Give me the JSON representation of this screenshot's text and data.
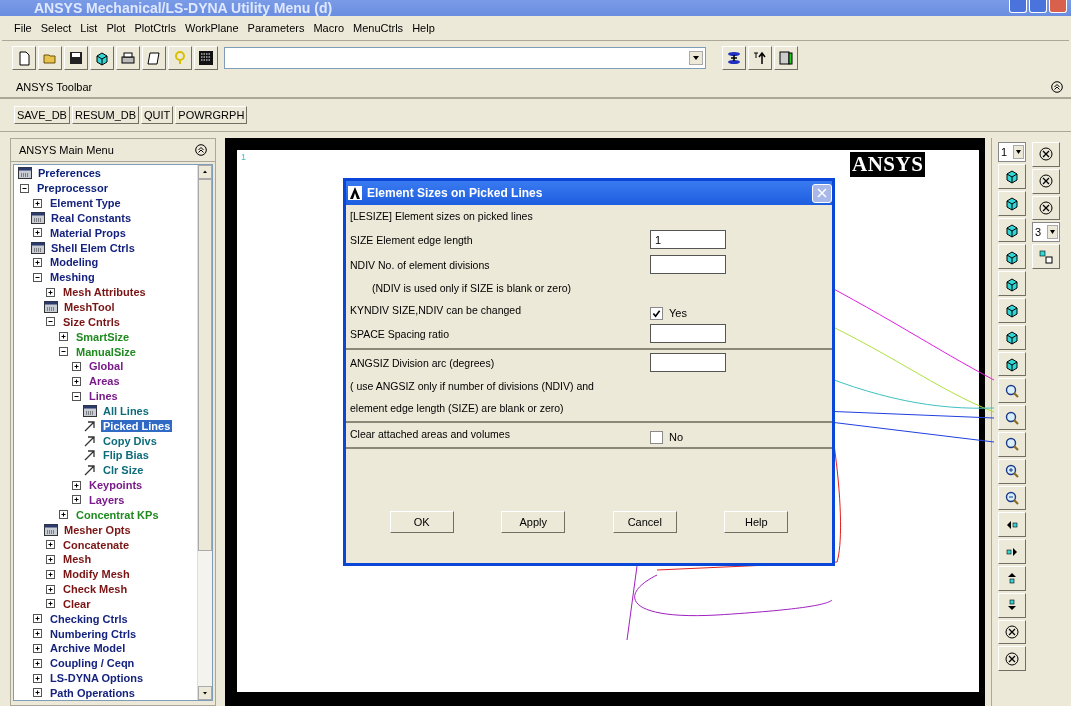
{
  "window": {
    "title": "ANSYS Mechanical/LS-DYNA Utility Menu (d)"
  },
  "menu": [
    "File",
    "Select",
    "List",
    "Plot",
    "PlotCtrls",
    "WorkPlane",
    "Parameters",
    "Macro",
    "MenuCtrls",
    "Help"
  ],
  "toolbar": {
    "title": "ANSYS Toolbar",
    "buttons": [
      "SAVE_DB",
      "RESUM_DB",
      "QUIT",
      "POWRGRPH"
    ]
  },
  "main_menu": {
    "title": "ANSYS Main Menu",
    "items": [
      {
        "label": "Preferences",
        "kind": "dialog",
        "selected": false
      },
      {
        "label": "Preprocessor",
        "kind": "folder",
        "expanded": true,
        "selected": false,
        "children": [
          {
            "label": "Element Type",
            "kind": "folder",
            "expanded": false,
            "selected": false
          },
          {
            "label": "Real Constants",
            "kind": "dialog",
            "selected": false
          },
          {
            "label": "Material Props",
            "kind": "folder",
            "expanded": false,
            "selected": false
          },
          {
            "label": "Shell Elem Ctrls",
            "kind": "dialog",
            "selected": false
          },
          {
            "label": "Modeling",
            "kind": "folder",
            "expanded": false,
            "selected": false
          },
          {
            "label": "Meshing",
            "kind": "folder",
            "expanded": true,
            "selected": false,
            "children": [
              {
                "label": "Mesh Attributes",
                "kind": "folder",
                "expanded": false,
                "selected": false
              },
              {
                "label": "MeshTool",
                "kind": "dialog",
                "selected": false
              },
              {
                "label": "Size Cntrls",
                "kind": "folder",
                "expanded": true,
                "selected": false,
                "children": [
                  {
                    "label": "SmartSize",
                    "kind": "folder",
                    "expanded": false,
                    "selected": false
                  },
                  {
                    "label": "ManualSize",
                    "kind": "folder",
                    "expanded": true,
                    "selected": false,
                    "children": [
                      {
                        "label": "Global",
                        "kind": "folder",
                        "expanded": false,
                        "selected": false
                      },
                      {
                        "label": "Areas",
                        "kind": "folder",
                        "expanded": false,
                        "selected": false
                      },
                      {
                        "label": "Lines",
                        "kind": "folder",
                        "expanded": true,
                        "selected": false,
                        "children": [
                          {
                            "label": "All Lines",
                            "kind": "dialog",
                            "selected": false
                          },
                          {
                            "label": "Picked Lines",
                            "kind": "picker",
                            "selected": true
                          },
                          {
                            "label": "Copy Divs",
                            "kind": "picker",
                            "selected": false
                          },
                          {
                            "label": "Flip Bias",
                            "kind": "picker",
                            "selected": false
                          },
                          {
                            "label": "Clr Size",
                            "kind": "picker",
                            "selected": false
                          }
                        ]
                      },
                      {
                        "label": "Keypoints",
                        "kind": "folder",
                        "expanded": false,
                        "selected": false
                      },
                      {
                        "label": "Layers",
                        "kind": "folder",
                        "expanded": false,
                        "selected": false
                      }
                    ]
                  },
                  {
                    "label": "Concentrat KPs",
                    "kind": "folder",
                    "expanded": false,
                    "selected": false
                  }
                ]
              },
              {
                "label": "Mesher Opts",
                "kind": "dialog",
                "selected": false
              },
              {
                "label": "Concatenate",
                "kind": "folder",
                "expanded": false,
                "selected": false
              },
              {
                "label": "Mesh",
                "kind": "folder",
                "expanded": false,
                "selected": false
              },
              {
                "label": "Modify Mesh",
                "kind": "folder",
                "expanded": false,
                "selected": false
              },
              {
                "label": "Check Mesh",
                "kind": "folder",
                "expanded": false,
                "selected": false
              },
              {
                "label": "Clear",
                "kind": "folder",
                "expanded": false,
                "selected": false
              }
            ]
          },
          {
            "label": "Checking Ctrls",
            "kind": "folder",
            "expanded": false,
            "selected": false
          },
          {
            "label": "Numbering Ctrls",
            "kind": "folder",
            "expanded": false,
            "selected": false
          },
          {
            "label": "Archive Model",
            "kind": "folder",
            "expanded": false,
            "selected": false
          },
          {
            "label": "Coupling / Ceqn",
            "kind": "folder",
            "expanded": false,
            "selected": false
          },
          {
            "label": "LS-DYNA Options",
            "kind": "folder",
            "expanded": false,
            "selected": false
          },
          {
            "label": "Path Operations",
            "kind": "folder",
            "expanded": false,
            "selected": false
          }
        ]
      }
    ]
  },
  "graphics": {
    "window_number": "1",
    "logo": "ANSYS"
  },
  "dialog": {
    "title": "Element Sizes on Picked Lines",
    "sections": [
      [
        {
          "kind": "heading",
          "label": "[LESIZE]  Element sizes on picked lines"
        },
        {
          "kind": "input",
          "label": "SIZE   Element edge length",
          "value": "1"
        },
        {
          "kind": "input",
          "label": "NDIV   No. of element divisions"
        },
        {
          "kind": "note",
          "label": "(NDIV is used only if SIZE is blank or zero)"
        },
        {
          "kind": "checkbox",
          "label": "KYNDIV  SIZE,NDIV can be changed",
          "checked": true,
          "option": "Yes"
        },
        {
          "kind": "input",
          "label": "SPACE   Spacing ratio"
        }
      ],
      [
        {
          "kind": "input",
          "label": "ANGSIZ  Division arc (degrees)"
        },
        {
          "kind": "heading",
          "label": "( use ANGSIZ only if number of divisions (NDIV) and"
        },
        {
          "kind": "heading",
          "label": "element edge length (SIZE) are blank or zero)"
        }
      ],
      [
        {
          "kind": "checkbox",
          "label": "Clear attached areas and volumes",
          "checked": false,
          "option": "No"
        }
      ]
    ],
    "buttons": [
      "OK",
      "Apply",
      "Cancel",
      "Help"
    ]
  },
  "right_toolbar": {
    "window_select": "1",
    "view_select": "3"
  }
}
